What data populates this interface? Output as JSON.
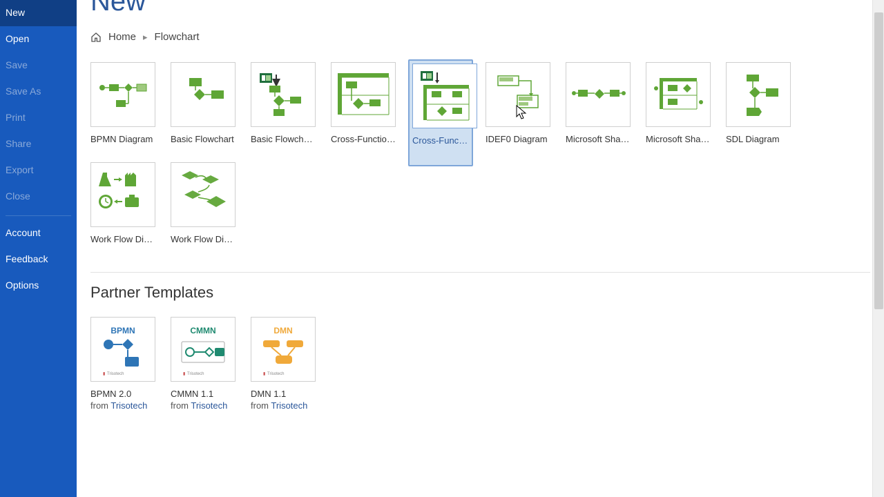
{
  "sidebar": {
    "new": "New",
    "open": "Open",
    "save": "Save",
    "save_as": "Save As",
    "print": "Print",
    "share": "Share",
    "export": "Export",
    "close": "Close",
    "account": "Account",
    "feedback": "Feedback",
    "options": "Options"
  },
  "page": {
    "title": "New"
  },
  "breadcrumb": {
    "home": "Home",
    "current": "Flowchart"
  },
  "templates": [
    {
      "label": "BPMN Diagram"
    },
    {
      "label": "Basic Flowchart"
    },
    {
      "label": "Basic Flowchart..."
    },
    {
      "label": "Cross-Functional..."
    },
    {
      "label": "Cross-Functional..."
    },
    {
      "label": "IDEF0 Diagram"
    },
    {
      "label": "Microsoft Share..."
    },
    {
      "label": "Microsoft Share..."
    },
    {
      "label": "SDL Diagram"
    },
    {
      "label": "Work Flow Diagr..."
    },
    {
      "label": "Work Flow Diagr..."
    }
  ],
  "selected_template_index": 4,
  "sections": {
    "partner": "Partner Templates"
  },
  "partner_templates": [
    {
      "badge": "BPMN",
      "label": "BPMN 2.0",
      "from": "from ",
      "vendor": "Trisotech"
    },
    {
      "badge": "CMMN",
      "label": "CMMN 1.1",
      "from": "from ",
      "vendor": "Trisotech"
    },
    {
      "badge": "DMN",
      "label": "DMN 1.1",
      "from": "from ",
      "vendor": "Trisotech"
    }
  ],
  "colors": {
    "accent": "#2b579a",
    "sidebar": "#185abd",
    "visio_green": "#5fa636",
    "orange": "#f0a93a",
    "blue2": "#2e75b6",
    "teal": "#1f8a70",
    "red": "#c94f4f"
  }
}
